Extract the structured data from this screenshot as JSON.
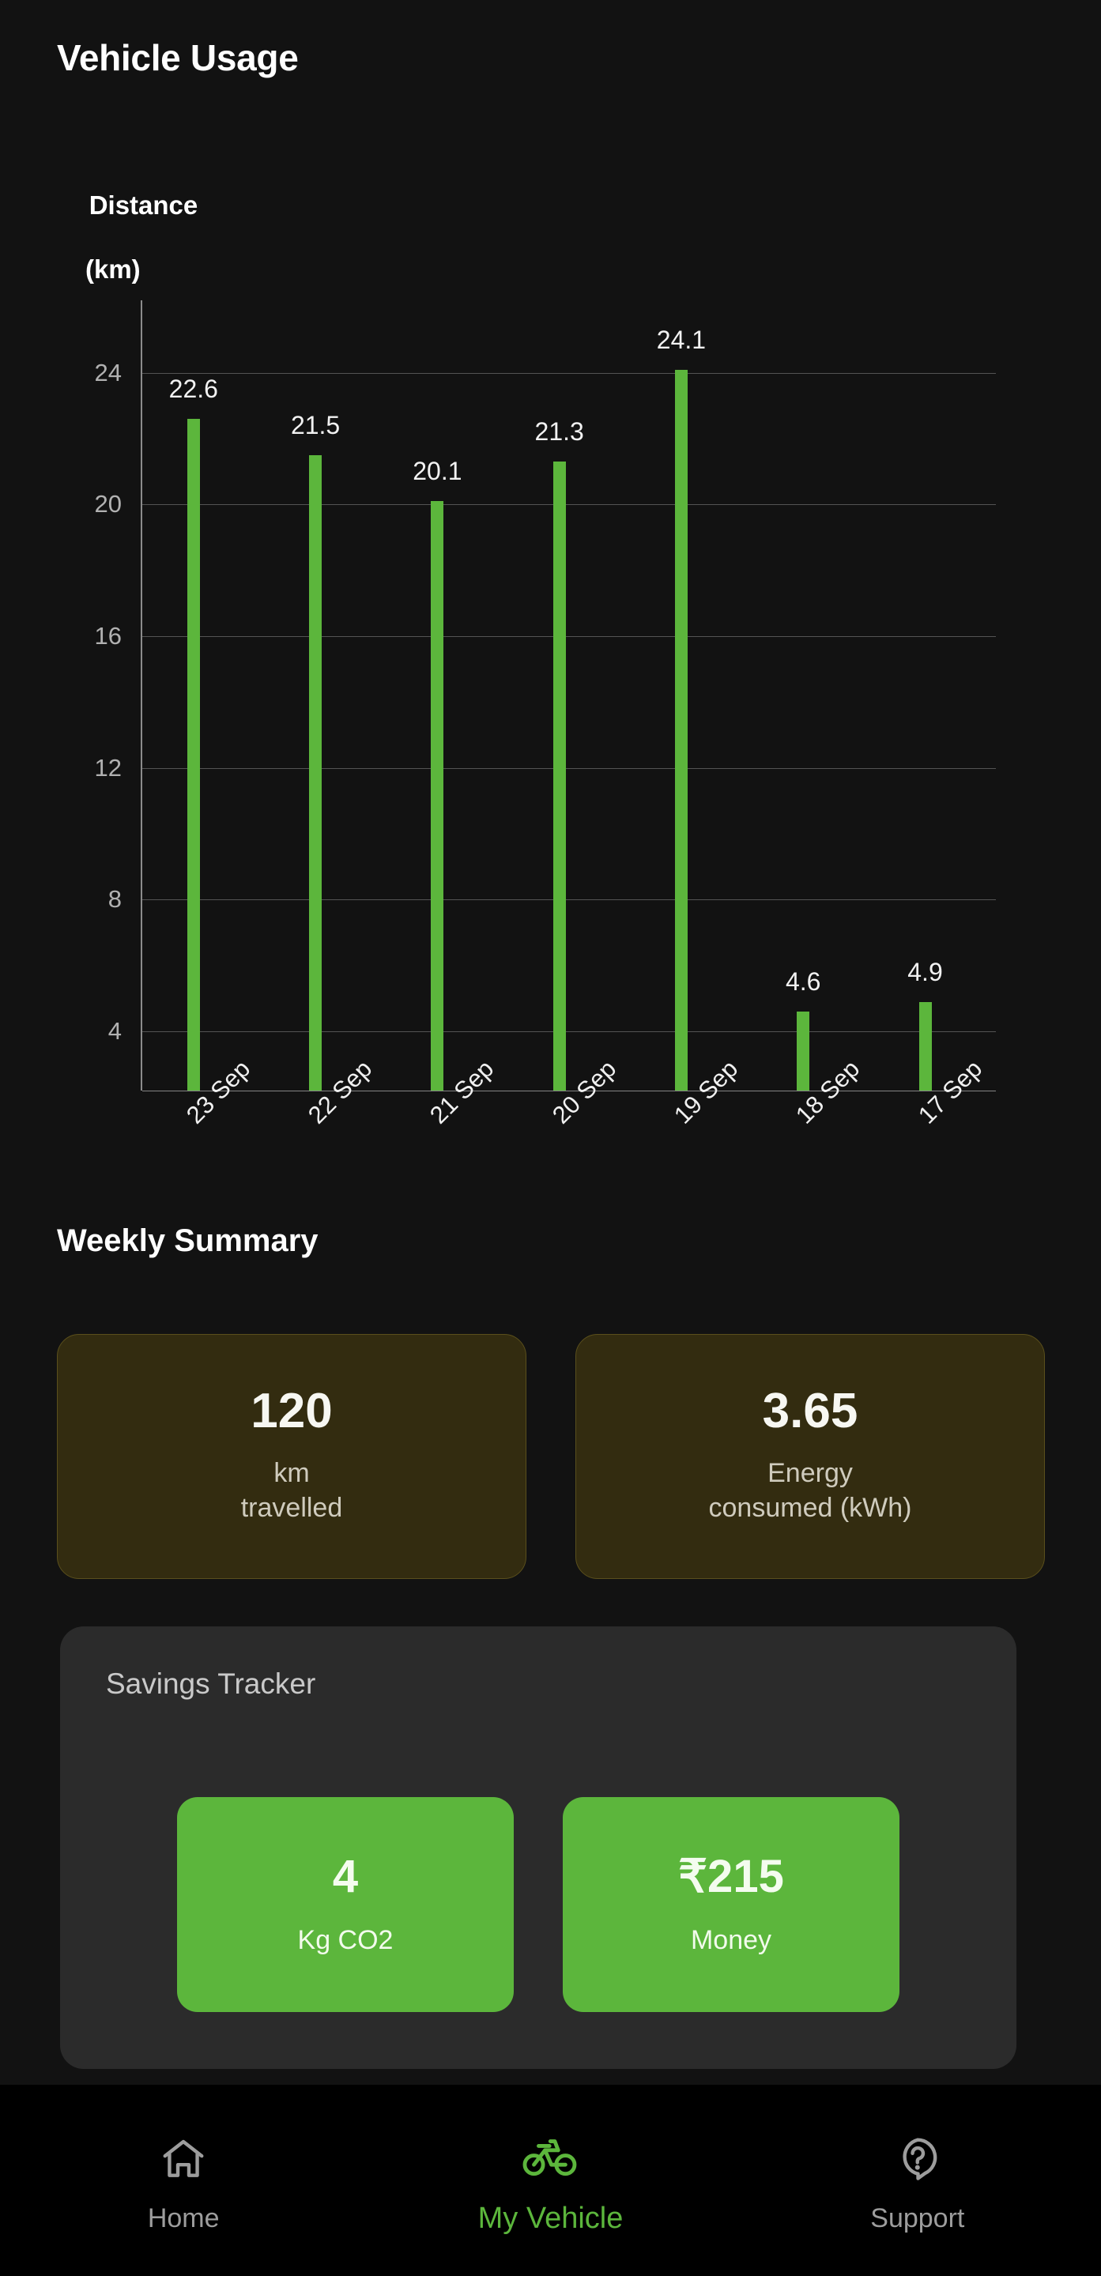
{
  "header": {
    "title": "Vehicle Usage"
  },
  "chart_data": {
    "type": "bar",
    "title": "Vehicle Usage",
    "ylabel": "Distance\n(km)",
    "ylabel_line1": "Distance",
    "ylabel_line2": "(km)",
    "xlabel": "",
    "categories": [
      "23 Sep",
      "22 Sep",
      "21 Sep",
      "20 Sep",
      "19 Sep",
      "18 Sep",
      "17 Sep"
    ],
    "values": [
      22.6,
      21.5,
      20.1,
      21.3,
      24.1,
      4.6,
      4.9
    ],
    "value_labels": [
      "22.6",
      "21.5",
      "20.1",
      "21.3",
      "24.1",
      "4.6",
      "4.9"
    ],
    "yticks": [
      4,
      8,
      12,
      16,
      20,
      24
    ],
    "ytick_labels": [
      "4",
      "8",
      "12",
      "16",
      "20",
      "24"
    ],
    "ylim": [
      2.2,
      26.2
    ],
    "grid": true,
    "legend": "none",
    "bar_color": "#5cb63c",
    "axis_color": "#8b8b8b",
    "grid_color": "#6e6e6e",
    "label_color": "#f2f2f2",
    "xtick_rotation": -45
  },
  "weekly_summary": {
    "title": "Weekly Summary",
    "cards": [
      {
        "value": "120",
        "caption": "km\ntravelled"
      },
      {
        "value": "3.65",
        "caption": "Energy\nconsumed (kWh)"
      }
    ]
  },
  "savings_tracker": {
    "title": "Savings Tracker",
    "chips": [
      {
        "value": "4",
        "caption": "Kg CO2"
      },
      {
        "value": "₹215",
        "caption": "Money"
      }
    ]
  },
  "bottom_nav": {
    "items": [
      {
        "label": "Home",
        "icon": "home-icon",
        "active": false
      },
      {
        "label": "My Vehicle",
        "icon": "bicycle-icon",
        "active": true
      },
      {
        "label": "Support",
        "icon": "help-bubble-icon",
        "active": false
      }
    ]
  },
  "colors": {
    "background": "#121212",
    "nav_background": "#000000",
    "accent_green": "#5cb63c",
    "summary_card_bg": "#332c10",
    "savings_card_bg": "#2b2b2b",
    "inactive_nav": "#9d9d9d"
  }
}
